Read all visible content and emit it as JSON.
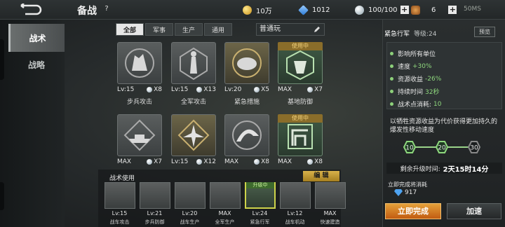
{
  "header": {
    "title": "备战",
    "help": "?",
    "gold": "10万",
    "diamonds": "1012",
    "energy": "100/100",
    "medals": "6",
    "stamina_status": "50MS"
  },
  "nav": {
    "items": [
      {
        "label": "战术",
        "active": true
      },
      {
        "label": "战略",
        "active": false
      }
    ]
  },
  "filters": {
    "tabs": [
      "全部",
      "军事",
      "生产",
      "通用"
    ],
    "active": "全部",
    "mode": "普通玩"
  },
  "cards": [
    {
      "name": "步兵攻击",
      "level": "Lv:15",
      "count": "X8",
      "in_use": false
    },
    {
      "name": "全军攻击",
      "level": "Lv:15",
      "count": "X13",
      "in_use": false
    },
    {
      "name": "紧急措施",
      "level": "Lv:20",
      "count": "X5",
      "in_use": false
    },
    {
      "name": "基地防御",
      "level": "MAX",
      "count": "X7",
      "in_use": true
    },
    {
      "name": "",
      "level": "MAX",
      "count": "X7",
      "in_use": false
    },
    {
      "name": "",
      "level": "Lv:15",
      "count": "X12",
      "in_use": false
    },
    {
      "name": "",
      "level": "MAX",
      "count": "X8",
      "in_use": false
    },
    {
      "name": "",
      "level": "MAX",
      "count": "X8",
      "in_use": true
    }
  ],
  "in_use_label": "使用中",
  "usage": {
    "label": "战术使用",
    "edit": "编 辑",
    "inuse_tag": "升级中",
    "slots": [
      {
        "level": "Lv:15",
        "name": "战车攻击"
      },
      {
        "level": "Lv:21",
        "name": "步兵防御"
      },
      {
        "level": "Lv:20",
        "name": "战车生产"
      },
      {
        "level": "MAX",
        "name": "全军生产"
      },
      {
        "level": "Lv:24",
        "name": "紧急行军",
        "selected": true
      },
      {
        "level": "Lv:12",
        "name": "战车机动"
      },
      {
        "level": "MAX",
        "name": "快速建造"
      }
    ]
  },
  "detail": {
    "name": "紧急行军",
    "level": "等级:24",
    "preview": "预览",
    "effects": [
      {
        "label": "影响所有单位",
        "value": ""
      },
      {
        "label": "速度",
        "value": "+30%"
      },
      {
        "label": "资源收益",
        "value": "-26%"
      },
      {
        "label": "持续时间",
        "value": "32秒"
      },
      {
        "label": "战术点消耗:",
        "value": "10"
      }
    ],
    "description": "以牺牲资源收益为代价获得更加持久的爆发性移动速度",
    "progress": {
      "steps": [
        "10",
        "20",
        "30"
      ],
      "done": 2
    },
    "timer_label": "剩余升级时间:",
    "timer_value": "2天15时14分",
    "cost_label": "立即完成将消耗",
    "cost_value": "917",
    "finish_btn": "立即完成",
    "speed_btn": "加速"
  },
  "colors": {
    "accent_green": "#8ed77d",
    "gold_btn": "#d8b24a",
    "orange_btn": "#e4a03a"
  }
}
